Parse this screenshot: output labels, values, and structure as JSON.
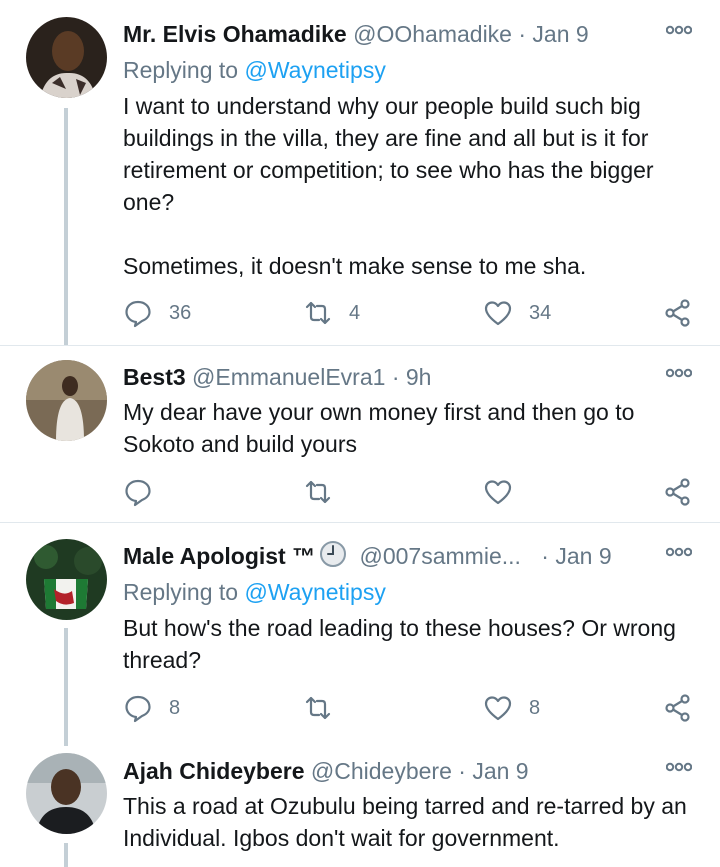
{
  "tweets": [
    {
      "name": "Mr. Elvis Ohamadike",
      "handle": "@OOhamadike",
      "time": "Jan 9",
      "replying_label": "Replying to",
      "replying_to": "@Waynetipsy",
      "text": "I want to understand why our people build such big buildings in the villa, they are fine and all but is it for retirement or competition; to see who has the bigger one?\n\nSometimes, it doesn't make sense to me sha.",
      "replies": "36",
      "retweets": "4",
      "likes": "34"
    },
    {
      "name": "Best3",
      "handle": "@EmmanuelEvra1",
      "time": "9h",
      "text": "My dear have your own money first and then go to Sokoto and build yours",
      "replies": "",
      "retweets": "",
      "likes": ""
    },
    {
      "name": "Male Apologist ™",
      "handle": "@007sammie...",
      "time": "Jan 9",
      "replying_label": "Replying to",
      "replying_to": "@Waynetipsy",
      "text": "But how's the road leading to these houses? Or wrong thread?",
      "replies": "8",
      "retweets": "",
      "likes": "8"
    },
    {
      "name": "Ajah Chideybere",
      "handle": "@Chideybere",
      "time": "Jan 9",
      "text": "This a road at Ozubulu being tarred and re-tarred by an Individual. Igbos don't wait for government."
    }
  ],
  "separator": "·",
  "icons": [
    "more-icon",
    "reply-icon",
    "retweet-icon",
    "like-icon",
    "share-icon",
    "clock-emoji-icon"
  ],
  "colors": {
    "link": "#1da1f2",
    "muted": "#657786",
    "thread_line": "#c4cfd6",
    "divider": "#e1e8ed"
  }
}
